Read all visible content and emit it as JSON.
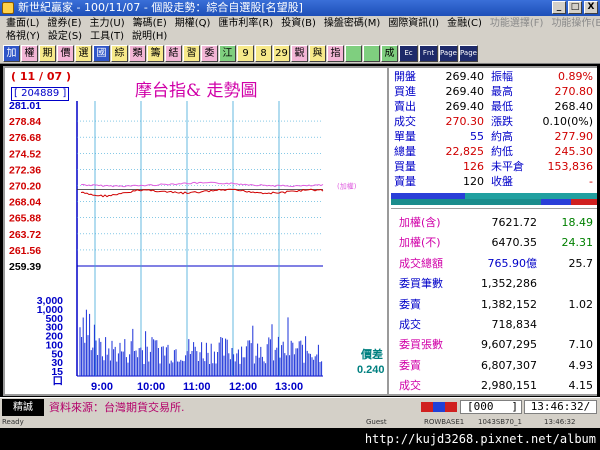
{
  "window": {
    "title": "新世紀贏家 - 100/11/07 - 個股走勢：綜合自選股[名望股]",
    "minimize": "_",
    "restore": "□",
    "close": "X"
  },
  "menu": {
    "row1": [
      "畫面(L)",
      "證券(E)",
      "主力(U)",
      "籌碼(E)",
      "期權(Q)",
      "匯市利率(R)",
      "投資(B)",
      "操盤密碼(M)",
      "國際資訊(I)",
      "金融(C)",
      "功能選擇(F)",
      "功能操作(B)"
    ],
    "row2": [
      "格視(Y)",
      "設定(S)",
      "工具(T)",
      "說明(H)"
    ]
  },
  "toolbar": {
    "buttons": [
      "加",
      "權",
      "期",
      "價",
      "選",
      "國",
      "綜",
      "類",
      "籌",
      "結",
      "習",
      "委",
      "江",
      "9",
      "8",
      "29",
      "觀",
      "與",
      "指",
      "",
      "",
      "成",
      "Ec",
      "Fnt",
      "Page",
      "Page"
    ]
  },
  "chart": {
    "date": "( 11 / 07 )",
    "volume_badge": "[ 204889 ]",
    "title": "摩台指&  走勢圖",
    "note_right": "(加權)",
    "price_labels": [
      "281.01",
      "278.84",
      "276.68",
      "274.52",
      "272.36",
      "270.20",
      "268.04",
      "265.88",
      "263.72",
      "261.56",
      "259.39"
    ],
    "volume_labels": [
      "3,000",
      "1,000",
      "500",
      "300",
      "200",
      "100",
      "50",
      "30",
      "15",
      "口"
    ],
    "time_labels": [
      "9:00",
      "10:00",
      "11:00",
      "12:00",
      "13:00"
    ],
    "spread_label": "價差",
    "spread_value": "0.240",
    "colors": {
      "axis_blue": "#0000c8",
      "price_red": "#d00000",
      "index_pink": "#e060e0",
      "grid_cyan": "#3fa9d8",
      "volume": "#1a30d8",
      "ref_line": "#2a2a2a"
    }
  },
  "chart_data": {
    "type": "line",
    "ylim": [
      259.39,
      281.01
    ],
    "xlabels": [
      "9:00",
      "10:00",
      "11:00",
      "12:00",
      "13:00"
    ],
    "series": []
  },
  "quote": {
    "rows": [
      {
        "l1": "開盤",
        "v1": "269.40",
        "l2": "振幅",
        "v2": "0.89%",
        "c1": "#000",
        "c2": "#d00000"
      },
      {
        "l1": "買進",
        "v1": "269.40",
        "l2": "最高",
        "v2": "270.80",
        "c1": "#000",
        "c2": "#d00000"
      },
      {
        "l1": "賣出",
        "v1": "269.40",
        "l2": "最低",
        "v2": "268.40",
        "c1": "#000",
        "c2": "#000"
      },
      {
        "l1": "成交",
        "v1": "270.30",
        "l2": "漲跌",
        "v2": "0.10(0%)",
        "c1": "#d00000",
        "c2": "#000"
      },
      {
        "l1": "單量",
        "v1": "55",
        "l2": "約高",
        "v2": "277.90",
        "c1": "#0000c8",
        "c2": "#d00000"
      },
      {
        "l1": "總量",
        "v1": "22,825",
        "l2": "約低",
        "v2": "245.30",
        "c1": "#d00000",
        "c2": "#d00000"
      },
      {
        "l1": "買量",
        "v1": "126",
        "l2": "未平倉",
        "v2": "153,836",
        "c1": "#d00000",
        "c2": "#d00000"
      },
      {
        "l1": "賣量",
        "v1": "120",
        "l2": "收盤",
        "v2": "-",
        "c1": "#000",
        "c2": "#d00000"
      }
    ],
    "lower": [
      {
        "label": "加權(含)",
        "value": "7621.72",
        "extra": "18.49",
        "lc": "#d000a8",
        "vc": "#000",
        "ec": "#008000",
        "bg": "#ffffff"
      },
      {
        "label": "加權(不)",
        "value": "6470.35",
        "extra": "24.31",
        "lc": "#d000a8",
        "vc": "#000",
        "ec": "#008000",
        "bg": "#ffffff"
      },
      {
        "label": "成交總額",
        "value": "765.90億",
        "extra": "25.7",
        "lc": "#d000a8",
        "vc": "#0000c8",
        "ec": "#000",
        "bg": "#ffffff"
      },
      {
        "label": "委買筆數",
        "value": "1,352,286",
        "extra": "",
        "lc": "#0000c8",
        "vc": "#000",
        "ec": "#000",
        "bg": "#ffffff"
      },
      {
        "label": "委賣",
        "value": "1,382,152",
        "extra": "1.02",
        "lc": "#0000c8",
        "vc": "#000",
        "ec": "#000",
        "bg": "#ffffff"
      },
      {
        "label": "成交",
        "value": "718,834",
        "extra": "",
        "lc": "#0000c8",
        "vc": "#000",
        "ec": "#000",
        "bg": "#ffffff"
      },
      {
        "label": "委買張數",
        "value": "9,607,295",
        "extra": "7.10",
        "lc": "#d000a8",
        "vc": "#000",
        "ec": "#000",
        "bg": "#ffffff"
      },
      {
        "label": "委賣",
        "value": "6,807,307",
        "extra": "4.93",
        "lc": "#d000a8",
        "vc": "#000",
        "ec": "#000",
        "bg": "#ffffff"
      },
      {
        "label": "成交",
        "value": "2,980,151",
        "extra": "4.15",
        "lc": "#d000a8",
        "vc": "#000",
        "ec": "#000",
        "bg": "#ffffff"
      }
    ]
  },
  "status": {
    "left_label": "精誠",
    "source": "資料來源：台灣期貨交易所.",
    "box_value": "[000",
    "box_close": "]",
    "time": "13:46:32/"
  },
  "footer": {
    "items": [
      "Ready",
      "Guest",
      "ROWBASE1",
      "1043SB70_1",
      "13:46:32"
    ],
    "url": "http://kujd3268.pixnet.net/album"
  }
}
